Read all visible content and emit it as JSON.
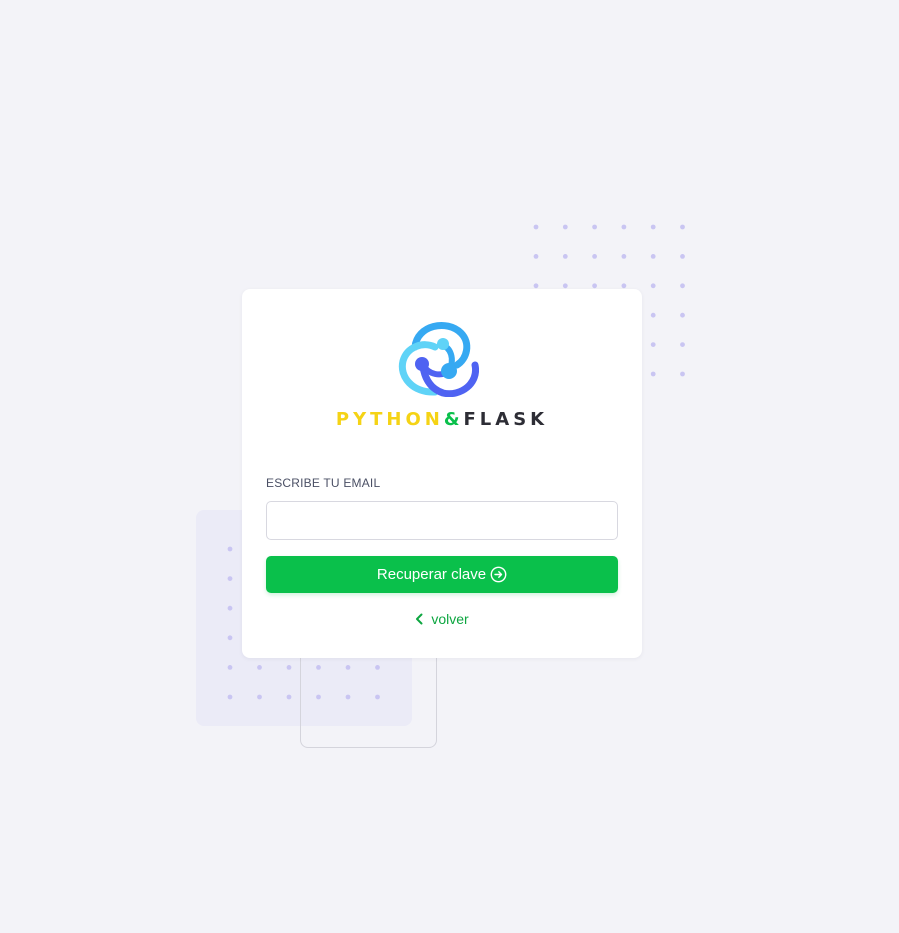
{
  "brand": {
    "part1": "PYTHON",
    "part2": "&",
    "part3": "FLASK",
    "colors": {
      "python": "#f5d315",
      "ampersand": "#0ac04b",
      "flask": "#2d2d35"
    }
  },
  "form": {
    "email_label": "ESCRIBE TU EMAIL",
    "email_value": "",
    "email_placeholder": "",
    "submit_label": "Recuperar clave",
    "submit_icon": "arrow-circle-right-icon",
    "back_label": "volver",
    "back_icon": "chevron-left-icon"
  },
  "theme": {
    "accent": "#0ac04b",
    "background": "#f3f3f8",
    "dot_color": "#c9c5f2"
  },
  "icons": {
    "logo": "python-flask-logo-icon"
  }
}
